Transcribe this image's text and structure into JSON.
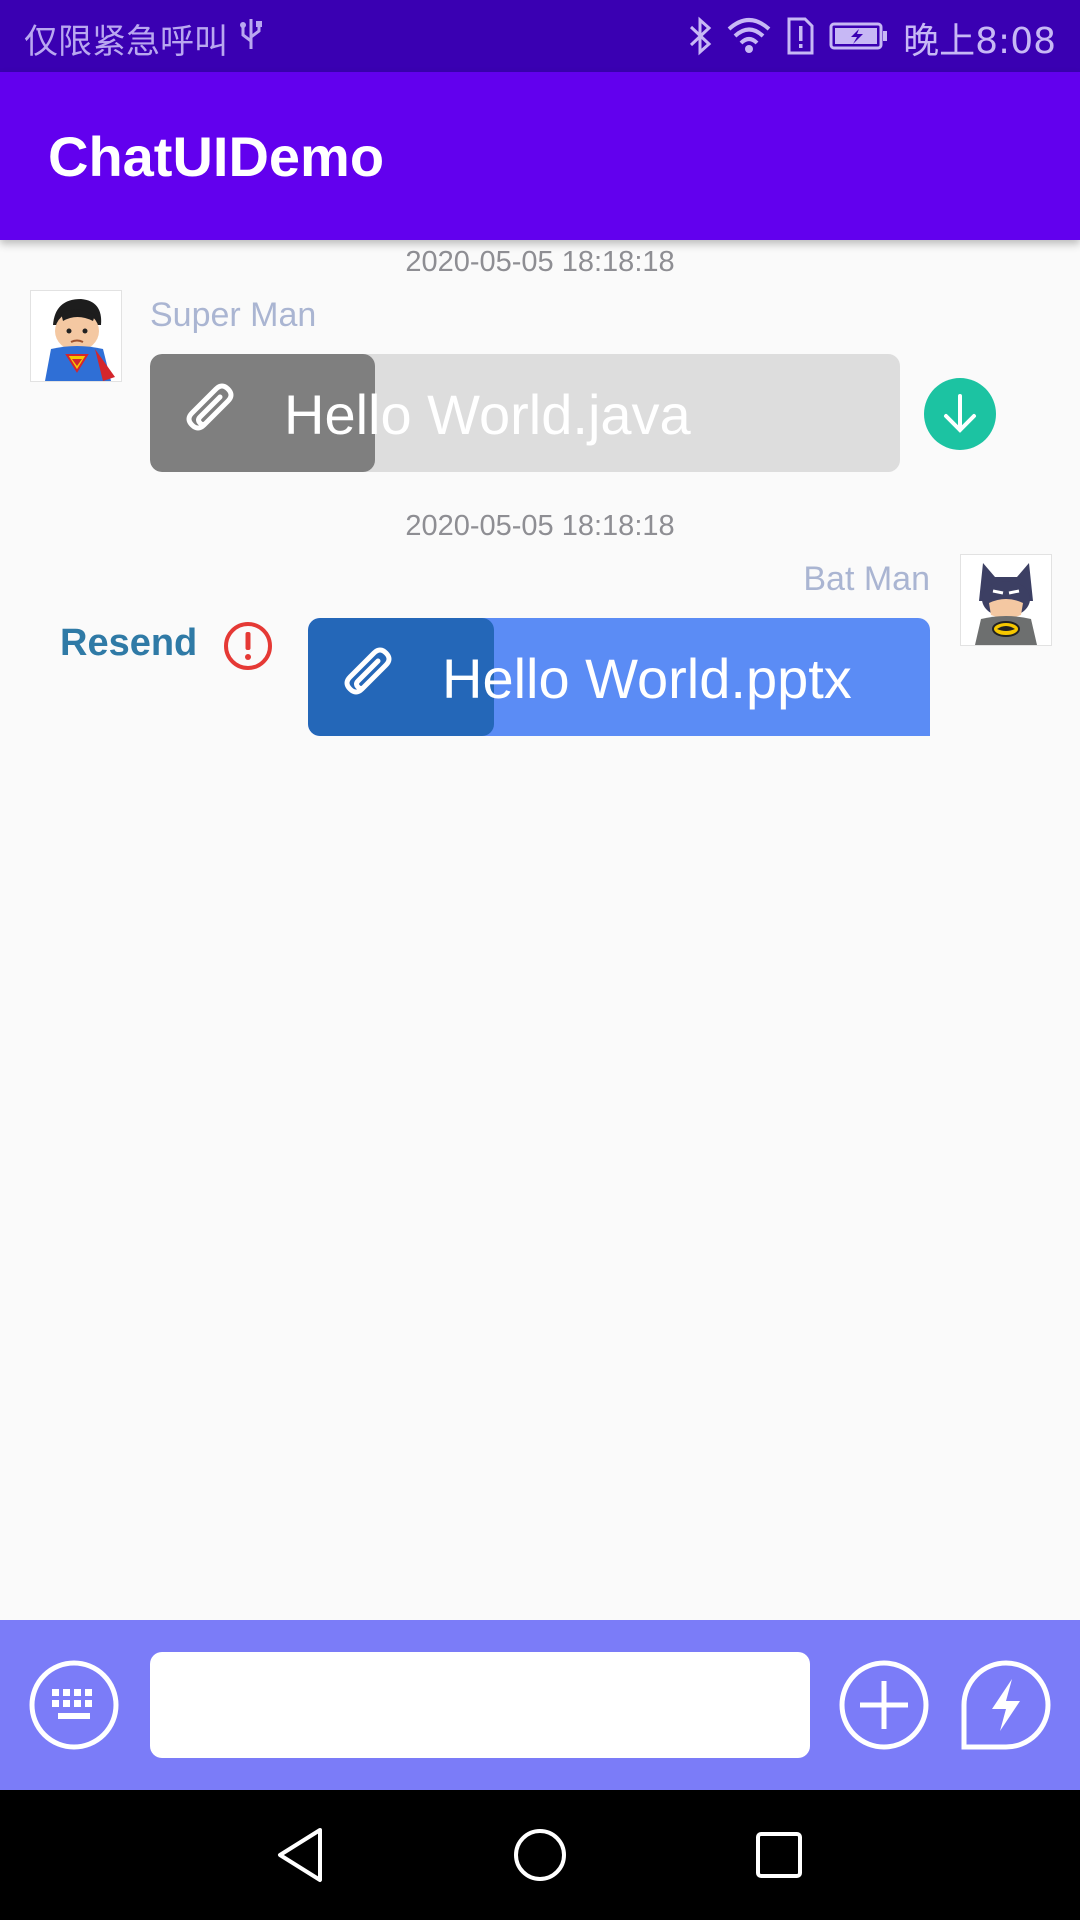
{
  "status_bar": {
    "emergency_text": "仅限紧急呼叫",
    "time": "晚上8:08",
    "icons": [
      "usb-icon",
      "bluetooth-icon",
      "wifi-icon",
      "sim-alert-icon",
      "battery-charging-icon"
    ]
  },
  "app_bar": {
    "title": "ChatUIDemo"
  },
  "messages": [
    {
      "timestamp": "2020-05-05 18:18:18",
      "sender": "Super Man",
      "direction": "incoming",
      "file_name": "Hello World.java",
      "progress_fraction": 0.3,
      "action_icon": "download-icon"
    },
    {
      "timestamp": "2020-05-05 18:18:18",
      "sender": "Bat Man",
      "direction": "outgoing",
      "file_name": "Hello World.pptx",
      "progress_fraction": 0.3,
      "resend_label": "Resend",
      "status_icon": "error-icon"
    }
  ],
  "input_bar": {
    "input_value": "",
    "left_icon": "keyboard-icon",
    "right_icons": [
      "plus-icon",
      "lightning-icon"
    ]
  },
  "nav_bar": {
    "icons": [
      "back-icon",
      "home-icon",
      "recents-icon"
    ]
  },
  "colors": {
    "status_bar": "#3a00b2",
    "app_bar": "#6200ee",
    "incoming_bubble": "#dddddd",
    "incoming_progress": "#7f7f7f",
    "outgoing_bubble": "#5b8cf5",
    "outgoing_progress": "#2467b8",
    "download_button": "#1cc3a2",
    "error": "#e53935",
    "input_bar": "#7b7cf8"
  }
}
